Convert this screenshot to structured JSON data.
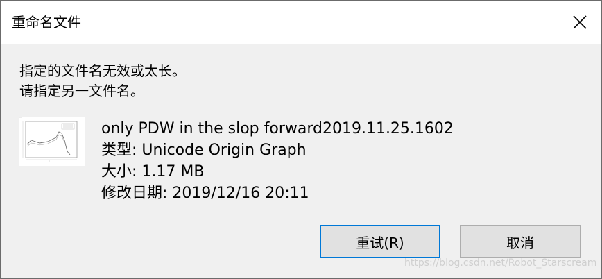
{
  "dialog": {
    "title": "重命名文件",
    "close_icon": "close-icon",
    "message_line1": "指定的文件名无效或太长。",
    "message_line2": "请指定另一文件名。"
  },
  "file": {
    "thumbnail_icon": "graph-thumbnail-icon",
    "name": "only PDW in the slop forward2019.11.25.1602",
    "type": "类型: Unicode Origin Graph",
    "size": "大小: 1.17 MB",
    "modified": "修改日期: 2019/12/16 20:11"
  },
  "buttons": {
    "retry_label": "重试(R)",
    "cancel_label": "取消"
  },
  "watermark": "https://blog.csdn.net/Robot_Starscream",
  "colors": {
    "accent": "#0078d7",
    "button_bg": "#e1e1e1",
    "dialog_bg": "#f0f0f0"
  }
}
